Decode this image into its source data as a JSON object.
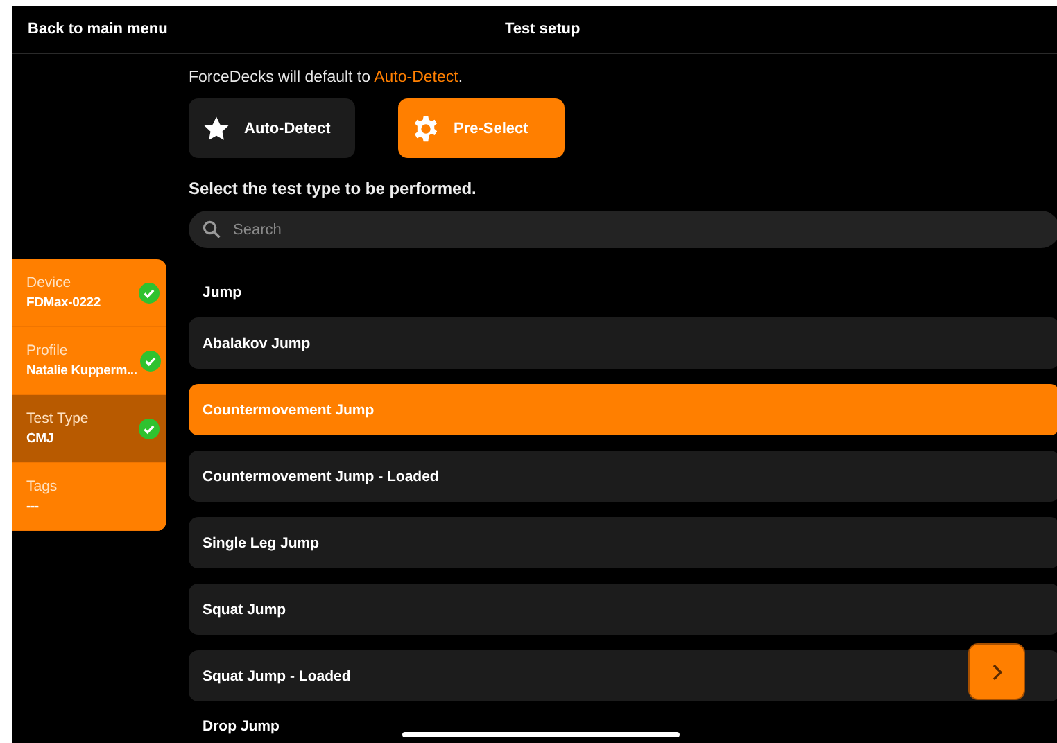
{
  "header": {
    "back": "Back to main menu",
    "title": "Test setup"
  },
  "intro": {
    "text": "ForceDecks will default to ",
    "highlight": "Auto-Detect",
    "end": "."
  },
  "modes": [
    {
      "label": "Auto-Detect",
      "kind": "star",
      "selected": false
    },
    {
      "label": "Pre-Select",
      "kind": "gear",
      "selected": true
    }
  ],
  "prompt": "Select the test type to be performed.",
  "search": {
    "placeholder": "Search"
  },
  "sidebar": {
    "items": [
      {
        "label": "Device",
        "value": "FDMax-0222",
        "checked": true,
        "selected": false
      },
      {
        "label": "Profile",
        "value": "Natalie Kupperm...",
        "checked": true,
        "selected": false
      },
      {
        "label": "Test Type",
        "value": "CMJ",
        "checked": true,
        "selected": true
      },
      {
        "label": "Tags",
        "value": "---",
        "checked": false,
        "selected": false
      }
    ]
  },
  "section": "Jump",
  "tests": [
    {
      "name": "Abalakov Jump",
      "selected": false
    },
    {
      "name": "Countermovement Jump",
      "selected": true
    },
    {
      "name": "Countermovement Jump - Loaded",
      "selected": false
    },
    {
      "name": "Single Leg Jump",
      "selected": false
    },
    {
      "name": "Squat Jump",
      "selected": false
    },
    {
      "name": "Squat Jump - Loaded",
      "selected": false
    }
  ],
  "next_section": "Drop Jump"
}
